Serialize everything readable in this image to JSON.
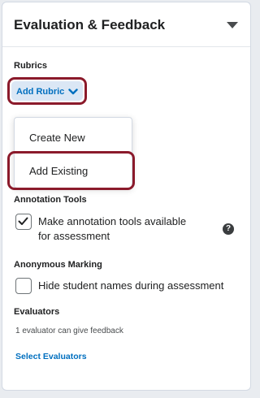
{
  "panel": {
    "title": "Evaluation & Feedback",
    "collapse_icon": "caret-down-icon"
  },
  "rubrics": {
    "label": "Rubrics",
    "add_button_label": "Add Rubric",
    "add_button_icon": "chevron-down-icon",
    "menu": [
      {
        "label": "Create New"
      },
      {
        "label": "Add Existing"
      }
    ]
  },
  "annotation_tools": {
    "label": "Annotation Tools",
    "checkbox_label_line1": "Make annotation tools available",
    "checkbox_label_line2": "for assessment",
    "checked": true,
    "help_icon": "help-icon"
  },
  "anonymous_marking": {
    "label": "Anonymous Marking",
    "checkbox_label": "Hide student names during assessment",
    "checked": false
  },
  "evaluators": {
    "label": "Evaluators",
    "info": "1 evaluator can give feedback",
    "link_label": "Select Evaluators"
  },
  "colors": {
    "highlight": "#8b1a2b",
    "link": "#006fbf",
    "button_bg": "#dbe7f5"
  }
}
